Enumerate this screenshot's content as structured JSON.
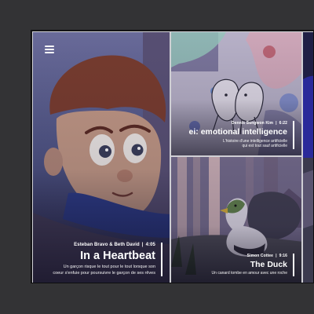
{
  "colors": {
    "page_bg": "#333335",
    "tile_border": "#cfcfd4",
    "text": "#ffffff"
  },
  "nav": {
    "menu_icon": "hamburger-menu-icon"
  },
  "films": [
    {
      "author": "Esteban Bravo & Beth David",
      "duration": "4:05",
      "title": "In a Heartbeat",
      "description_line1": "Un garçon risque le tout pour le tout lorsque son",
      "description_line2": "coeur s'enfuie pour poursuivre le garçon de ses rêves"
    },
    {
      "author": "Dennis Sungwon Kim",
      "duration": "6:22",
      "title": "ei: emotional intelligence",
      "description_line1": "L'histoire d'une intelligence artificielle",
      "description_line2": "qui est tout sauf artificielle"
    },
    {
      "author": "Simon Cottee",
      "duration": "9:16",
      "title": "The Duck",
      "description_line1": "Un canard tombe en amour avec une roche",
      "description_line2": ""
    },
    {
      "author": "",
      "duration": "",
      "title": "",
      "description_line1": "",
      "description_line2": ""
    }
  ]
}
